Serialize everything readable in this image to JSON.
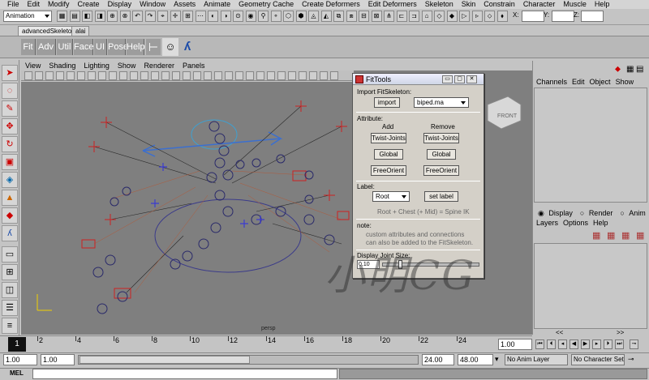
{
  "menu": [
    "File",
    "Edit",
    "Modify",
    "Create",
    "Display",
    "Window",
    "Assets",
    "Animate",
    "Geometry Cache",
    "Create Deformers",
    "Edit Deformers",
    "Skeleton",
    "Skin",
    "Constrain",
    "Character",
    "Muscle",
    "Help"
  ],
  "status": {
    "mode": "Animation",
    "x_label": "X:",
    "y_label": "Y:",
    "z_label": "Z:"
  },
  "shelf_tabs": [
    "advancedSkeleton",
    "alai"
  ],
  "shelf_buttons": [
    "Fit",
    "Adv",
    "Util",
    "Face",
    "UI",
    "Pose",
    "Help"
  ],
  "panel_menu": [
    "View",
    "Shading",
    "Lighting",
    "Show",
    "Renderer",
    "Panels"
  ],
  "viewport": {
    "camera_label": "persp",
    "cube_label": "FRONT"
  },
  "fittools": {
    "title": "FitTools",
    "win_min": "▭",
    "win_max": "▢",
    "win_close": "✕",
    "import_section": "Import FitSkeleton:",
    "import_btn": "import",
    "import_file": "biped.ma",
    "attribute_section": "Attribute:",
    "add": "Add",
    "remove": "Remove",
    "twist_add": "Twist-Joints",
    "twist_remove": "Twist-Joints",
    "global_add": "Global",
    "global_remove": "Global",
    "free_add": "FreeOrient",
    "free_remove": "FreeOrient",
    "label_section": "Label:",
    "label_value": "Root",
    "set_label": "set label",
    "label_hint": "Root + Chest (+ Mid) = Spine IK",
    "note_title": "note:",
    "note_line1": "custom attributes and connections",
    "note_line2": "can also be added to the FitSkeleton.",
    "joint_size_label": "Display Joint Size:",
    "joint_size_value": "0.10"
  },
  "channel_box": {
    "menu": [
      "Channels",
      "Edit",
      "Object",
      "Show"
    ]
  },
  "layer_editor": {
    "tabs": [
      "Display",
      "Render",
      "Anim"
    ],
    "menu": [
      "Layers",
      "Options",
      "Help"
    ]
  },
  "timeline": {
    "current": "1",
    "ticks": [
      "2",
      "4",
      "6",
      "8",
      "10",
      "12",
      "14",
      "16",
      "18",
      "20",
      "22",
      "24"
    ],
    "current_time": "1.00"
  },
  "range": {
    "start": "1.00",
    "start2": "1.00",
    "end": "24.00",
    "end2": "48.00",
    "anim_layer": "No Anim Layer",
    "character_set": "No Character Set"
  },
  "command": {
    "label": "MEL"
  },
  "watermark": "小明CG",
  "colors": {
    "viewport_bg": "#7f7f7f",
    "joint_blue": "#2a2a6a",
    "joint_red": "#cc2222",
    "curve_blue": "#3b6fd0"
  }
}
